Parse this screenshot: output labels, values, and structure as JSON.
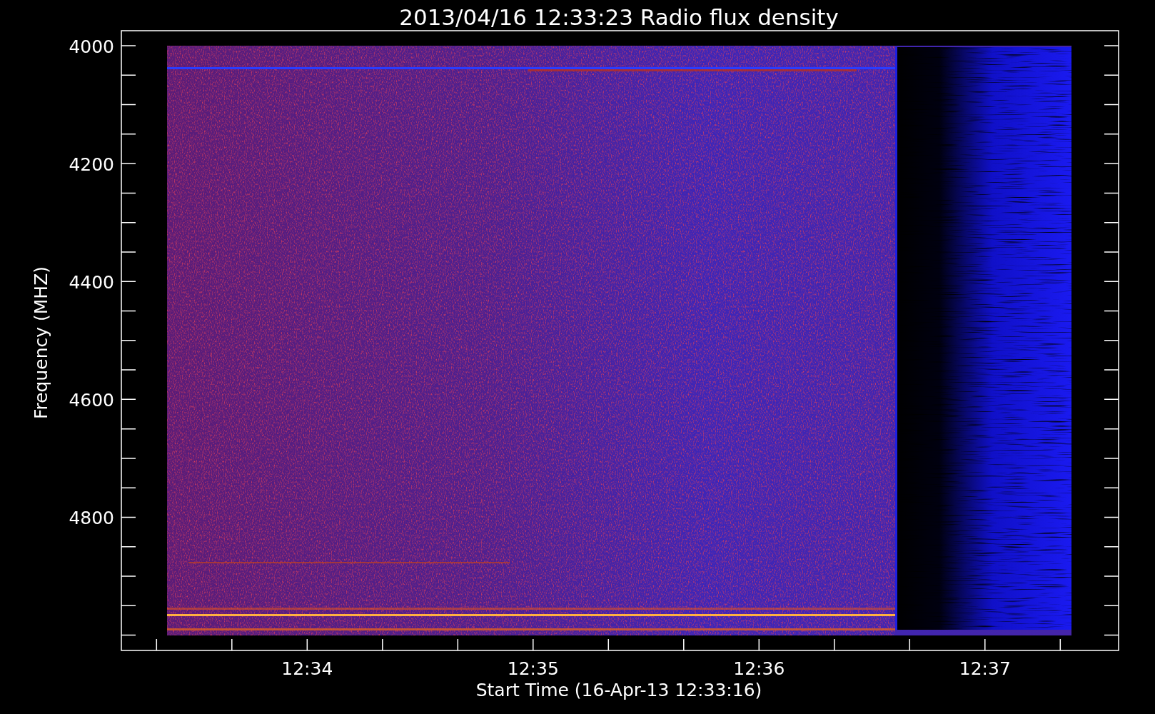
{
  "title": "2013/04/16 12:33:23 Radio flux density",
  "y_axis": {
    "label": "Frequency (MHZ)",
    "ticks": [
      "4000",
      "4200",
      "4400",
      "4600",
      "4800"
    ]
  },
  "x_axis": {
    "label": "Start Time (16-Apr-13 12:33:16)",
    "ticks": [
      "12:34",
      "12:35",
      "12:36",
      "12:37"
    ]
  }
}
